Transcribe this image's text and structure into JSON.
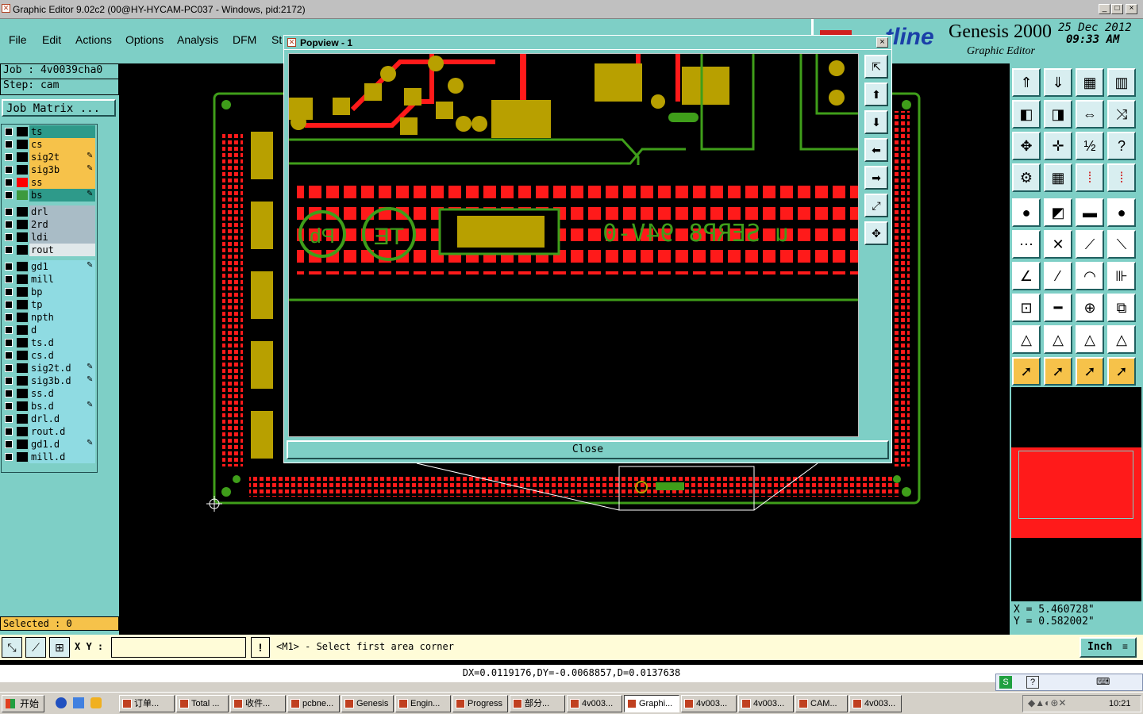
{
  "window": {
    "title": "Graphic Editor 9.02c2 (00@HY-HYCAM-PC037 - Windows, pid:2172)",
    "btn_min": "_",
    "btn_max": "□",
    "btn_close": "×"
  },
  "menu": {
    "items": [
      "File",
      "Edit",
      "Actions",
      "Options",
      "Analysis",
      "DFM",
      "St"
    ]
  },
  "brand": {
    "logo": "tline",
    "product": "Genesis 2000",
    "subtitle": "Graphic Editor",
    "date": "25 Dec 2012",
    "time": "09:33 AM"
  },
  "job": {
    "job_line": "Job : 4v0039cha0",
    "step_line": "Step: cam",
    "matrix_button": "Job Matrix ..."
  },
  "layers": [
    {
      "name": "ts",
      "color": "#2e9a8a",
      "swatch": "#000000",
      "flag": ""
    },
    {
      "name": "cs",
      "color": "#f6c24a",
      "swatch": "#000000",
      "flag": ""
    },
    {
      "name": "sig2t",
      "color": "#f6c24a",
      "swatch": "#000000",
      "flag": "✎"
    },
    {
      "name": "sig3b",
      "color": "#f6c24a",
      "swatch": "#000000",
      "flag": "✎"
    },
    {
      "name": "ss",
      "color": "#f6c24a",
      "swatch": "#ff0000",
      "flag": ""
    },
    {
      "name": "bs",
      "color": "#2e9a8a",
      "swatch": "#3d9a3d",
      "flag": "✎"
    },
    {
      "name": "drl",
      "color": "#a9bcc6",
      "swatch": "#000000",
      "flag": ""
    },
    {
      "name": "2rd",
      "color": "#a9bcc6",
      "swatch": "#000000",
      "flag": ""
    },
    {
      "name": "ldi",
      "color": "#a9bcc6",
      "swatch": "#000000",
      "flag": ""
    },
    {
      "name": "rout",
      "color": "#e0e8ea",
      "swatch": "#000000",
      "flag": ""
    },
    {
      "name": "gd1",
      "color": "#8fdbe2",
      "swatch": "#000000",
      "flag": "✎"
    },
    {
      "name": "mill",
      "color": "#8fdbe2",
      "swatch": "#000000",
      "flag": ""
    },
    {
      "name": "bp",
      "color": "#8fdbe2",
      "swatch": "#000000",
      "flag": ""
    },
    {
      "name": "tp",
      "color": "#8fdbe2",
      "swatch": "#000000",
      "flag": ""
    },
    {
      "name": "npth",
      "color": "#8fdbe2",
      "swatch": "#000000",
      "flag": ""
    },
    {
      "name": "d",
      "color": "#8fdbe2",
      "swatch": "#000000",
      "flag": ""
    },
    {
      "name": "ts.d",
      "color": "#8fdbe2",
      "swatch": "#000000",
      "flag": ""
    },
    {
      "name": "cs.d",
      "color": "#8fdbe2",
      "swatch": "#000000",
      "flag": ""
    },
    {
      "name": "sig2t.d",
      "color": "#8fdbe2",
      "swatch": "#000000",
      "flag": "✎"
    },
    {
      "name": "sig3b.d",
      "color": "#8fdbe2",
      "swatch": "#000000",
      "flag": "✎"
    },
    {
      "name": "ss.d",
      "color": "#8fdbe2",
      "swatch": "#000000",
      "flag": ""
    },
    {
      "name": "bs.d",
      "color": "#8fdbe2",
      "swatch": "#000000",
      "flag": "✎"
    },
    {
      "name": "drl.d",
      "color": "#8fdbe2",
      "swatch": "#000000",
      "flag": ""
    },
    {
      "name": "rout.d",
      "color": "#8fdbe2",
      "swatch": "#000000",
      "flag": ""
    },
    {
      "name": "gd1.d",
      "color": "#8fdbe2",
      "swatch": "#000000",
      "flag": "✎"
    },
    {
      "name": "mill.d",
      "color": "#8fdbe2",
      "swatch": "#000000",
      "flag": ""
    }
  ],
  "selected": "Selected : 0",
  "popview": {
    "title": "Popview - 1",
    "close_button": "Close",
    "silk_text": "u SERP8 94V-0",
    "badge_pb": "Pb",
    "badge_te": "TE"
  },
  "coords": {
    "x": "X  =  5.460728\"",
    "y": "Y  =  0.582002\""
  },
  "command": {
    "xy_label": "X Y :",
    "xy_value": "",
    "prompt": "<M1> - Select first area corner",
    "unit": "Inch"
  },
  "status_line": "DX=0.0119176,DY=-0.0068857,D=0.0137638",
  "taskbar": {
    "start": "开始",
    "tasks": [
      "订单...",
      "Total ...",
      "收件...",
      "pcbne...",
      "Genesis",
      "Engin...",
      "Progress",
      "部分...",
      "4v003...",
      "Graphi...",
      "4v003...",
      "4v003...",
      "CAM...",
      "4v003..."
    ],
    "clock": "10:21"
  },
  "colors": {
    "panel": "#7ecfc6",
    "pad_red": "#ff1a1a",
    "gold": "#b8a000",
    "trace_green": "#3f9e1a"
  }
}
